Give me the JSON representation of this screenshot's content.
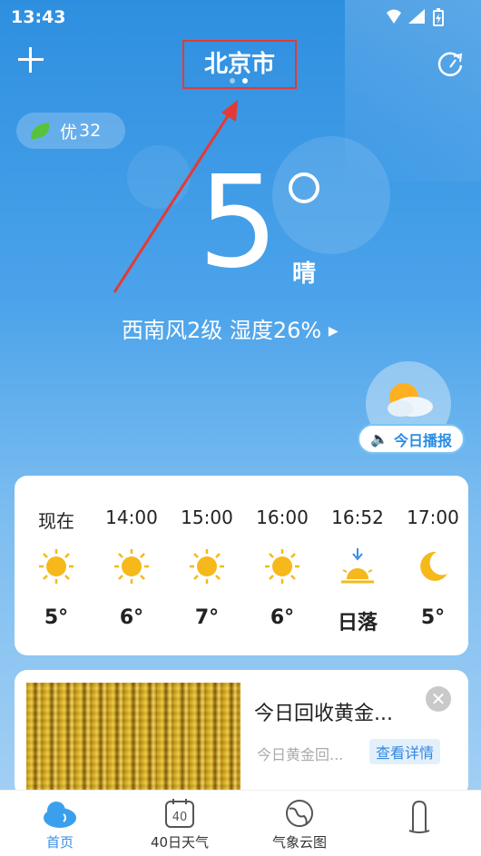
{
  "status_bar": {
    "time": "13:43"
  },
  "header": {
    "city": "北京市"
  },
  "aqi": {
    "label": "优",
    "value": "32"
  },
  "current": {
    "temperature": "5",
    "condition": "晴",
    "wind_humidity": "西南风2级  湿度26%"
  },
  "broadcast": {
    "label": "今日播报"
  },
  "hourly": [
    {
      "time": "现在",
      "icon": "sun-icon",
      "value": "5°"
    },
    {
      "time": "14:00",
      "icon": "sun-icon",
      "value": "6°"
    },
    {
      "time": "15:00",
      "icon": "sun-icon",
      "value": "7°"
    },
    {
      "time": "16:00",
      "icon": "sun-icon",
      "value": "6°"
    },
    {
      "time": "16:52",
      "icon": "sunset-icon",
      "value": "日落"
    },
    {
      "time": "17:00",
      "icon": "moon-icon",
      "value": "5°"
    }
  ],
  "ad": {
    "title": "今日回收黄金...",
    "subtitle": "今日黄金回...",
    "button": "查看详情"
  },
  "tabs": [
    {
      "label": "首页",
      "icon": "cloud-home-icon",
      "active": true
    },
    {
      "label": "40日天气",
      "icon": "calendar-40-icon",
      "icon_text": "40"
    },
    {
      "label": "气象云图",
      "icon": "globe-icon"
    },
    {
      "label": "",
      "icon": "profile-icon"
    }
  ],
  "colors": {
    "sky_top": "#2e8fe0",
    "accent": "#2a8ce6",
    "highlight_box": "#e53935",
    "sun": "#f6b81a"
  }
}
